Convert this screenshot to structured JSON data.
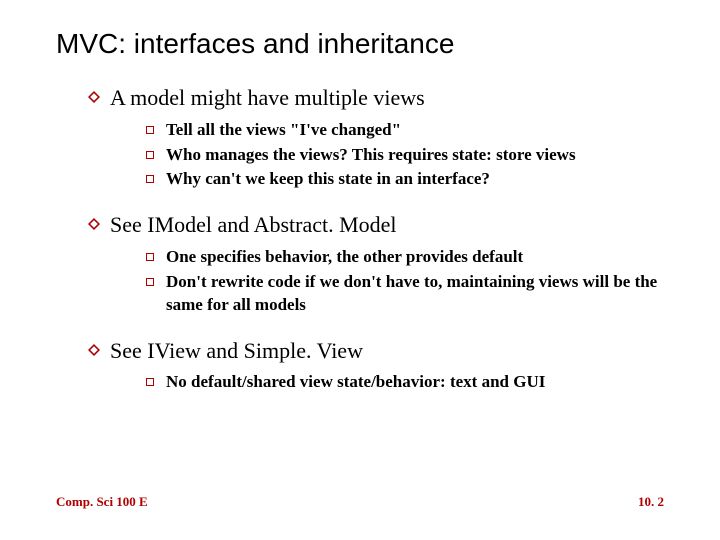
{
  "title": "MVC: interfaces and inheritance",
  "sections": [
    {
      "heading": "A model might have multiple views",
      "items": [
        "Tell all the views \"I've changed\"",
        "Who manages the views? This requires state: store views",
        "Why can't we keep this state in an interface?"
      ]
    },
    {
      "heading": "See IModel and Abstract. Model",
      "items": [
        "One specifies behavior, the other provides default",
        "Don't rewrite code if we don't have to, maintaining views will be the same for all models"
      ]
    },
    {
      "heading": "See IView and Simple. View",
      "items": [
        "No default/shared view state/behavior: text and GUI"
      ]
    }
  ],
  "footer": {
    "left": "Comp. Sci 100 E",
    "right": "10. 2"
  }
}
